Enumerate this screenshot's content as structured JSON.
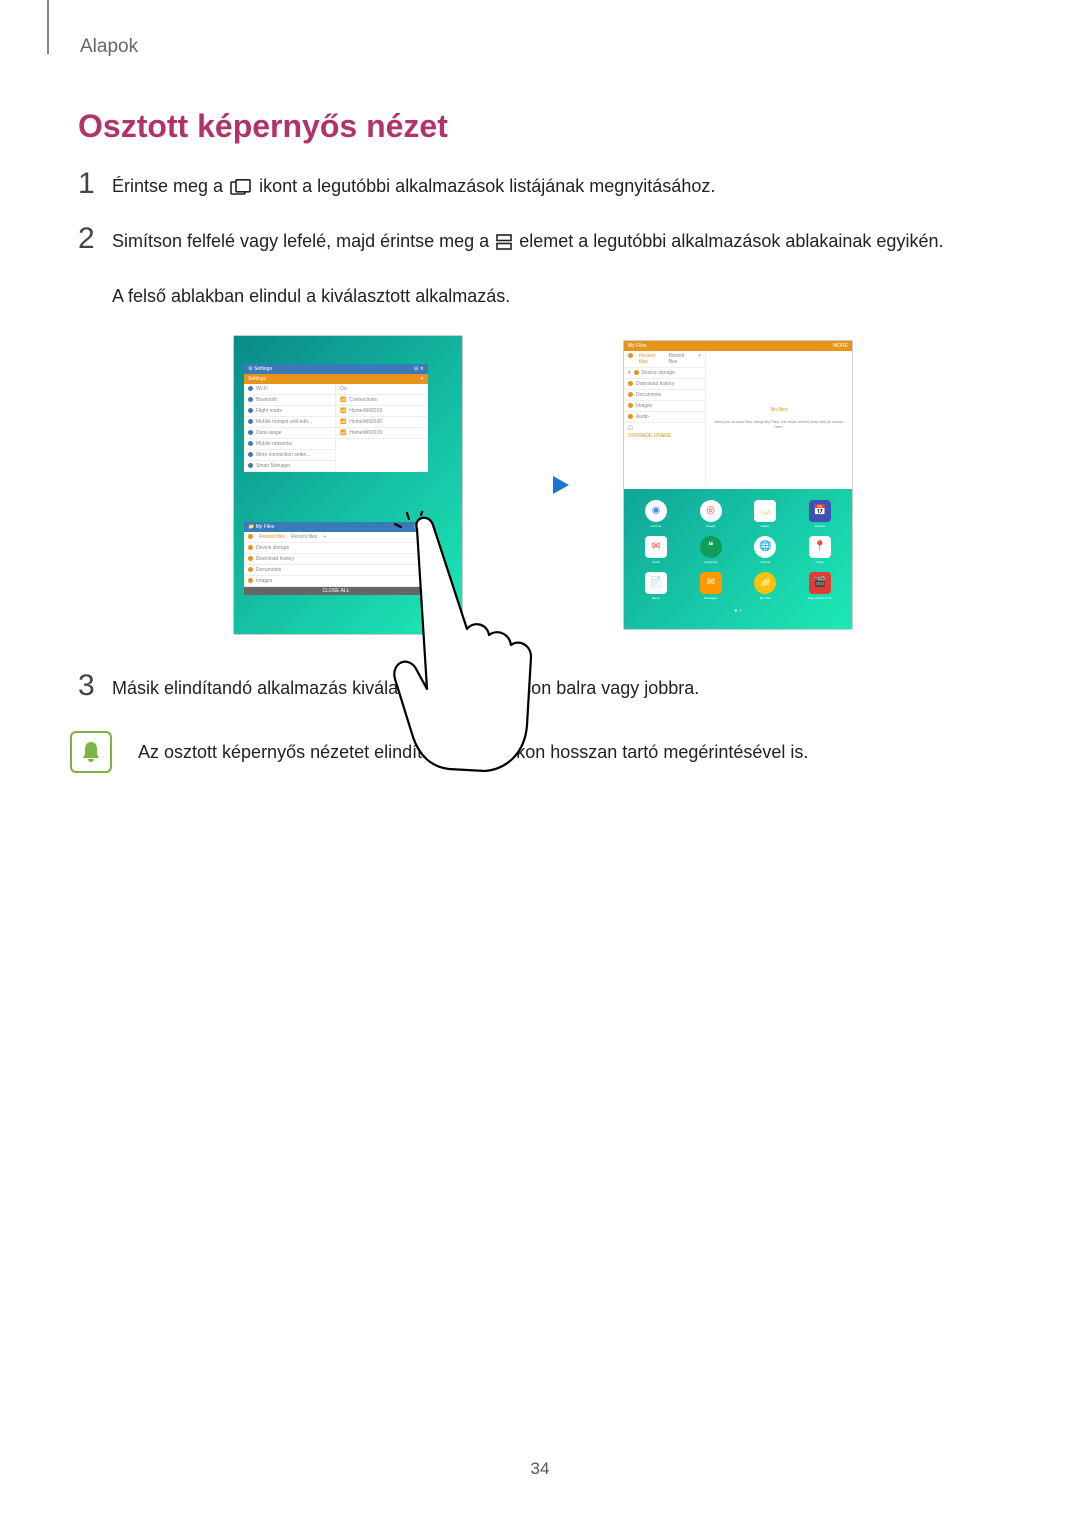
{
  "header": {
    "chapter": "Alapok"
  },
  "section": {
    "title": "Osztott képernyős nézet"
  },
  "steps": [
    {
      "num": "1",
      "text_before": "Érintse meg a ",
      "text_after": " ikont a legutóbbi alkalmazások listájának megnyitásához."
    },
    {
      "num": "2",
      "text_before": "Simítson felfelé vagy lefelé, majd érintse meg a ",
      "text_after": " elemet a legutóbbi alkalmazások ablakainak egyikén.",
      "sub": "A felső ablakban elindul a kiválasztott alkalmazás."
    },
    {
      "num": "3",
      "text": "Másik elindítandó alkalmazás kiválasztásához simítson balra vagy jobbra."
    }
  ],
  "note": {
    "text_before": "Az osztott képernyős nézetet elindíthatja a ",
    "text_after": " ikon hosszan tartó megérintésével is."
  },
  "page_number": "34",
  "illustration": {
    "left_tablet": {
      "app1": {
        "header": "Settings",
        "rows": [
          "Settings",
          "Wi-Fi",
          "Bluetooth",
          "Flight mode",
          "Mobile hotspot and teth...",
          "Data usage",
          "Mobile networks",
          "More connection settin...",
          "Smart Manager"
        ],
        "right_col": [
          "On",
          "Connections",
          "HomeWifi2019",
          "HomeWifi2020",
          "HomeWifi2019"
        ]
      },
      "app2": {
        "header": "My Files",
        "tabs": [
          "Recent files",
          "Recent files",
          "+"
        ],
        "rows": [
          "Device storage",
          "Download history",
          "Documents",
          "Images"
        ],
        "footer": "CLOSE ALL"
      }
    },
    "right_tablet": {
      "header": {
        "title": "My Files",
        "more": "MORE"
      },
      "side": {
        "tabs": [
          "Recent files",
          "Recent files",
          "+"
        ],
        "items": [
          "Device storage",
          "Download history",
          "Documents",
          "Images",
          "Audio"
        ],
        "storage": "STORAGE USAGE"
      },
      "main": {
        "empty_title": "No files",
        "empty_sub": "After you access files using My Files, the most recent ones will be shown here."
      },
      "apps": [
        [
          "Chrome",
          "Google",
          "Gallery",
          "Planner"
        ],
        [
          "Gmail",
          "Hangouts",
          "Internet",
          "Maps"
        ],
        [
          "Memo",
          "Messages",
          "My Files",
          "Play Movies & TV"
        ]
      ]
    }
  }
}
